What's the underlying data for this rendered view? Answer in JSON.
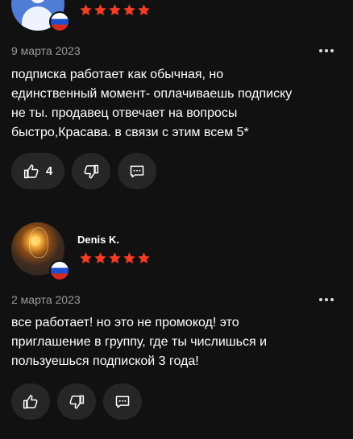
{
  "colors": {
    "background": "#111111",
    "text": "#ffffff",
    "muted": "#9a9a9a",
    "star": "#f23c26",
    "button": "#262626"
  },
  "icons": {
    "rating": "star-icon",
    "like": "thumbs-up-icon",
    "dislike": "thumbs-down-icon",
    "reply": "comment-icon",
    "menu": "more-icon",
    "flag": "russia-flag-icon"
  },
  "reviews": [
    {
      "author": "",
      "rating": 5,
      "date": "9 марта 2023",
      "text": "подписка работает как обычная, но\nединственный момент- оплачиваешь подписку\nне ты. продавец отвечает на вопросы\nбыстро,Красава. в связи с этим всем 5*",
      "likes": "4"
    },
    {
      "author": "Denis K.",
      "rating": 5,
      "date": "2 марта 2023",
      "text": "все работает! но это не промокод! это\nприглашение в группу, где ты числишься и\nпользуешься подпиской 3 года!",
      "likes": ""
    }
  ]
}
